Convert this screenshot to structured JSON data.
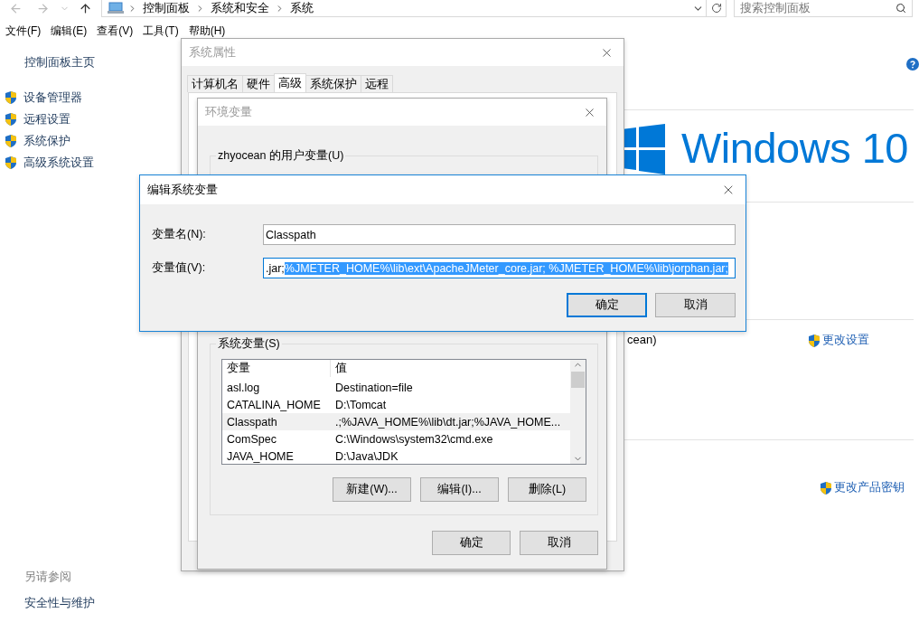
{
  "explorer": {
    "breadcrumb": [
      "控制面板",
      "系统和安全",
      "系统"
    ],
    "search": {
      "placeholder": "搜索控制面板"
    },
    "menu": [
      "文件(F)",
      "编辑(E)",
      "查看(V)",
      "工具(T)",
      "帮助(H)"
    ],
    "sidebar": {
      "home": "控制面板主页",
      "items": [
        "设备管理器",
        "远程设置",
        "系统保护",
        "高级系统设置"
      ]
    },
    "see_also": {
      "title": "另请参阅",
      "links": [
        "安全性与维护"
      ]
    },
    "logo_text": "Windows 10",
    "owner_fragment": "cean)",
    "links": [
      "更改设置",
      "更改产品密钥"
    ]
  },
  "system_properties": {
    "title": "系统属性",
    "active": false,
    "tabs": [
      {
        "label": "计算机名",
        "selected": false
      },
      {
        "label": "硬件",
        "selected": false
      },
      {
        "label": "高级",
        "selected": true
      },
      {
        "label": "系统保护",
        "selected": false
      },
      {
        "label": "远程",
        "selected": false
      }
    ]
  },
  "environment_variables": {
    "title": "环境变量",
    "active": false,
    "user_group": "zhyocean 的用户变量(U)",
    "system_group": "系统变量(S)",
    "columns": [
      "变量",
      "值"
    ],
    "rows": [
      {
        "name": "asl.log",
        "value": "Destination=file",
        "selected": false
      },
      {
        "name": "CATALINA_HOME",
        "value": "D:\\Tomcat",
        "selected": false
      },
      {
        "name": "Classpath",
        "value": ".;%JAVA_HOME%\\lib\\dt.jar;%JAVA_HOME...",
        "selected": true
      },
      {
        "name": "ComSpec",
        "value": "C:\\Windows\\system32\\cmd.exe",
        "selected": false
      },
      {
        "name": "JAVA_HOME",
        "value": "D:\\Java\\JDK",
        "selected": false
      }
    ],
    "buttons": [
      "新建(W)...",
      "编辑(I)...",
      "删除(L)"
    ],
    "footer_buttons": [
      "确定",
      "取消"
    ]
  },
  "edit_dialog": {
    "title": "编辑系统变量",
    "active": true,
    "name_label": "变量名(N):",
    "name_value": "Classpath",
    "value_label": "变量值(V):",
    "value_unselected": ".jar;",
    "value_selected": "%JMETER_HOME%\\lib\\ext\\ApacheJMeter_core.jar; %JMETER_HOME%\\lib\\jorphan.jar;",
    "buttons": [
      {
        "label": "确定",
        "default": true
      },
      {
        "label": "取消",
        "default": false
      }
    ]
  }
}
